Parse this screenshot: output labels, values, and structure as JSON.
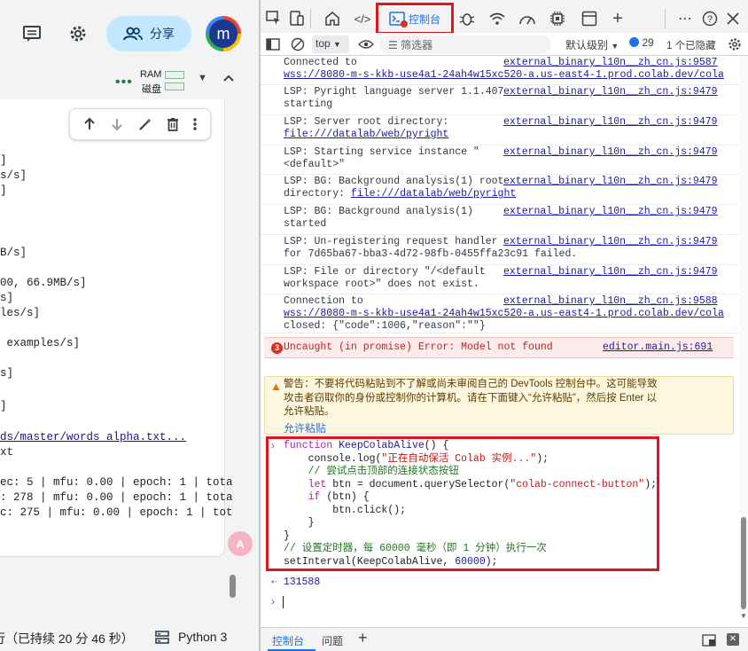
{
  "left": {
    "share_label": "分享",
    "avatar_letter": "m",
    "ram_label": "RAM",
    "disk_label": "磁盘",
    "output_lines": [
      "]",
      "s/s]",
      "]",
      "",
      "",
      "B/s]",
      "",
      "00, 66.9MB/s]",
      "s]",
      "les/s]",
      "",
      " examples/s]",
      "",
      "s]",
      "",
      "]",
      "",
      "ds/master/words_alpha.txt...",
      "xt",
      "",
      "ec: 5 | mfu: 0.00 | epoch: 1 | tota",
      ": 278 | mfu: 0.00 | epoch: 1 | tota",
      "c: 275 | mfu: 0.00 | epoch: 1 | tot"
    ],
    "status_text": "行（已持续 20 分 46 秒）",
    "runtime": "Python 3"
  },
  "devtools": {
    "console_tab_label": "控制台",
    "context": "top",
    "filter_placeholder": "筛选器",
    "level": "默认级别",
    "issues_count": "29",
    "hidden_count": "1 个已隐藏",
    "logs": [
      {
        "msg": "Connected to\nwss://8080-m-s-kkb-use4a1-24ah4w15xc520-a.us-east4-1.prod.colab.dev/cola",
        "src": "external_binary_l10n__zh_cn.js:9587"
      },
      {
        "msg": "LSP: Pyright language server 1.1.407\nstarting",
        "src": "external_binary_l10n__zh_cn.js:9479"
      },
      {
        "msg": "LSP: Server root directory:\nfile:///datalab/web/pyright",
        "src": "external_binary_l10n__zh_cn.js:9479"
      },
      {
        "msg": "LSP: Starting service instance \"\n<default>\"",
        "src": "external_binary_l10n__zh_cn.js:9479"
      },
      {
        "msg": "LSP: BG: Background analysis(1) root\ndirectory: file:///datalab/web/pyright",
        "src": "external_binary_l10n__zh_cn.js:9479"
      },
      {
        "msg": "LSP: BG: Background analysis(1)\nstarted",
        "src": "external_binary_l10n__zh_cn.js:9479"
      },
      {
        "msg": "LSP: Un-registering request handler\nfor 7d65ba67-bba3-4d72-98fb-0455ffa23c91 failed.",
        "src": "external_binary_l10n__zh_cn.js:9479"
      },
      {
        "msg": "LSP: File or directory \"/<default\nworkspace root>\" does not exist.",
        "src": "external_binary_l10n__zh_cn.js:9479"
      },
      {
        "msg": "Connection to\nwss://8080-m-s-kkb-use4a1-24ah4w15xc520-a.us-east4-1.prod.colab.dev/cola\nclosed: {\"code\":1006,\"reason\":\"\"}",
        "src": "external_binary_l10n__zh_cn.js:9588"
      }
    ],
    "error": {
      "count": "3",
      "msg": "Uncaught (in promise) Error: Model not found",
      "src": "editor.main.js:691"
    },
    "warning_text": "警告：不要将代码粘贴到不了解或尚未审阅自己的 DevTools 控制台中。这可能导致\n攻击者窃取你的身份或控制你的计算机。请在下面键入“允许粘贴”，然后按 Enter 以\n允许粘贴。",
    "allow_paste": "允许粘贴",
    "result": "131588",
    "drawer_tabs": [
      "控制台",
      "问题"
    ]
  },
  "colors": {
    "highlight": "#e0161e",
    "link": "#1a1aa6",
    "accent": "#1a73e8"
  }
}
